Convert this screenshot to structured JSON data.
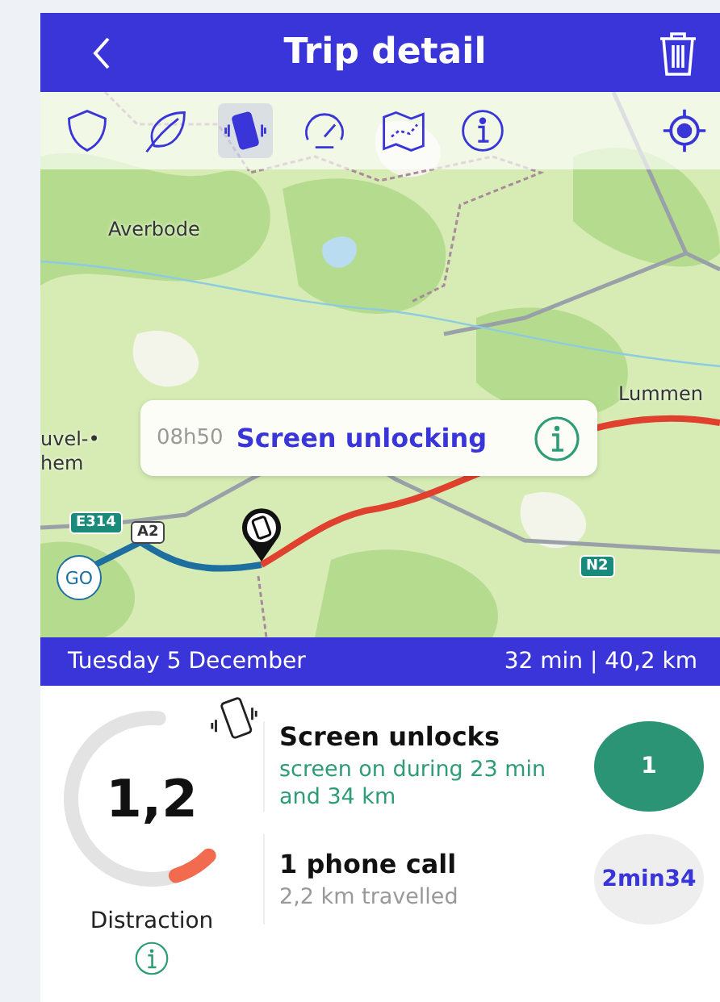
{
  "header": {
    "title": "Trip detail"
  },
  "toolbar": {
    "tabs": [
      {
        "kind": "shield",
        "selected": false
      },
      {
        "kind": "leaf",
        "selected": false
      },
      {
        "kind": "phone",
        "selected": true
      },
      {
        "kind": "gauge",
        "selected": false
      },
      {
        "kind": "map",
        "selected": false
      },
      {
        "kind": "info",
        "selected": false
      }
    ]
  },
  "map": {
    "labels": [
      "Averbode",
      "Lummen",
      "uvel-•",
      "hem"
    ],
    "road_signs": [
      {
        "text": "E314",
        "kind": "motorway"
      },
      {
        "text": "A2",
        "kind": "road"
      },
      {
        "text": "N2",
        "kind": "motorway"
      }
    ],
    "start": "GO",
    "popup": {
      "time": "08h50",
      "title": "Screen unlocking"
    }
  },
  "summary": {
    "date": "Tuesday 5 December",
    "stats": "32 min | 40,2 km"
  },
  "score": {
    "value": "1,2",
    "level": 0.12,
    "label": "Distraction"
  },
  "events": [
    {
      "title": "Screen unlocks",
      "subtitle": "screen on during 23 min and 34 km",
      "badge": "1",
      "kind": "count"
    },
    {
      "title": "1 phone call",
      "subtitle": "2,2 km travelled",
      "badge": "2min34",
      "kind": "duration"
    }
  ]
}
